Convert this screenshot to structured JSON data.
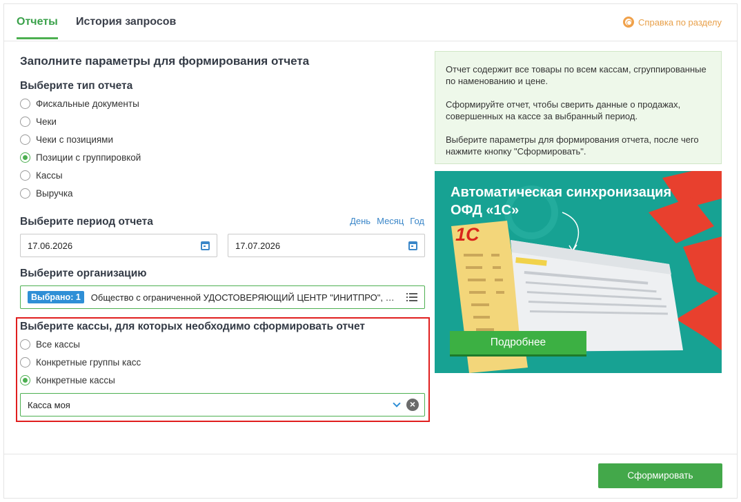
{
  "tabs": [
    {
      "label": "Отчеты",
      "active": true
    },
    {
      "label": "История запросов",
      "active": false
    }
  ],
  "help": {
    "label": "Справка по разделу",
    "icon": "lifebuoy-icon"
  },
  "form": {
    "title": "Заполните параметры для формирования отчета",
    "report_type": {
      "label": "Выберите тип отчета",
      "options": [
        {
          "label": "Фискальные документы",
          "checked": false
        },
        {
          "label": "Чеки",
          "checked": false
        },
        {
          "label": "Чеки с позициями",
          "checked": false
        },
        {
          "label": "Позиции с группировкой",
          "checked": true
        },
        {
          "label": "Кассы",
          "checked": false
        },
        {
          "label": "Выручка",
          "checked": false
        }
      ]
    },
    "period": {
      "label": "Выберите период отчета",
      "links": [
        "День",
        "Месяц",
        "Год"
      ],
      "date_from": "17.06.2026",
      "date_to": "17.07.2026"
    },
    "organization": {
      "label": "Выберите организацию",
      "badge": "Выбрано: 1",
      "value": "Общество с ограниченной УДОСТОВЕРЯЮЩИЙ ЦЕНТР \"ИНИТПРО\", ООО"
    },
    "kassa": {
      "label": "Выберите кассы, для которых необходимо сформировать отчет",
      "options": [
        {
          "label": "Все кассы",
          "checked": false
        },
        {
          "label": "Конкретные группы касс",
          "checked": false
        },
        {
          "label": "Конкретные кассы",
          "checked": true
        }
      ],
      "selected": "Касса моя",
      "clear_symbol": "×"
    }
  },
  "info": {
    "paragraphs": [
      "Отчет содержит все товары по всем кассам, сгруппированные по наменованию и цене.",
      "Сформируйте отчет, чтобы сверить данные о продажах, совершенных на кассе за выбранный период.",
      "Выберите параметры для формирования отчета, после чего нажмите кнопку \"Сформировать\"."
    ]
  },
  "banner": {
    "title_line1": "Автоматическая синхронизация",
    "title_line2": "ОФД «1С»",
    "logo_text": "1С",
    "button_label": "Подробнее",
    "colors": {
      "background": "#17a293",
      "accent": "#e8402e",
      "button": "#3cb043"
    }
  },
  "footer": {
    "submit_label": "Сформировать"
  },
  "colors": {
    "accent_green": "#4caf50",
    "link_blue": "#3a86c8",
    "highlight_red": "#e01e1e",
    "help_orange": "#e8a04a"
  }
}
